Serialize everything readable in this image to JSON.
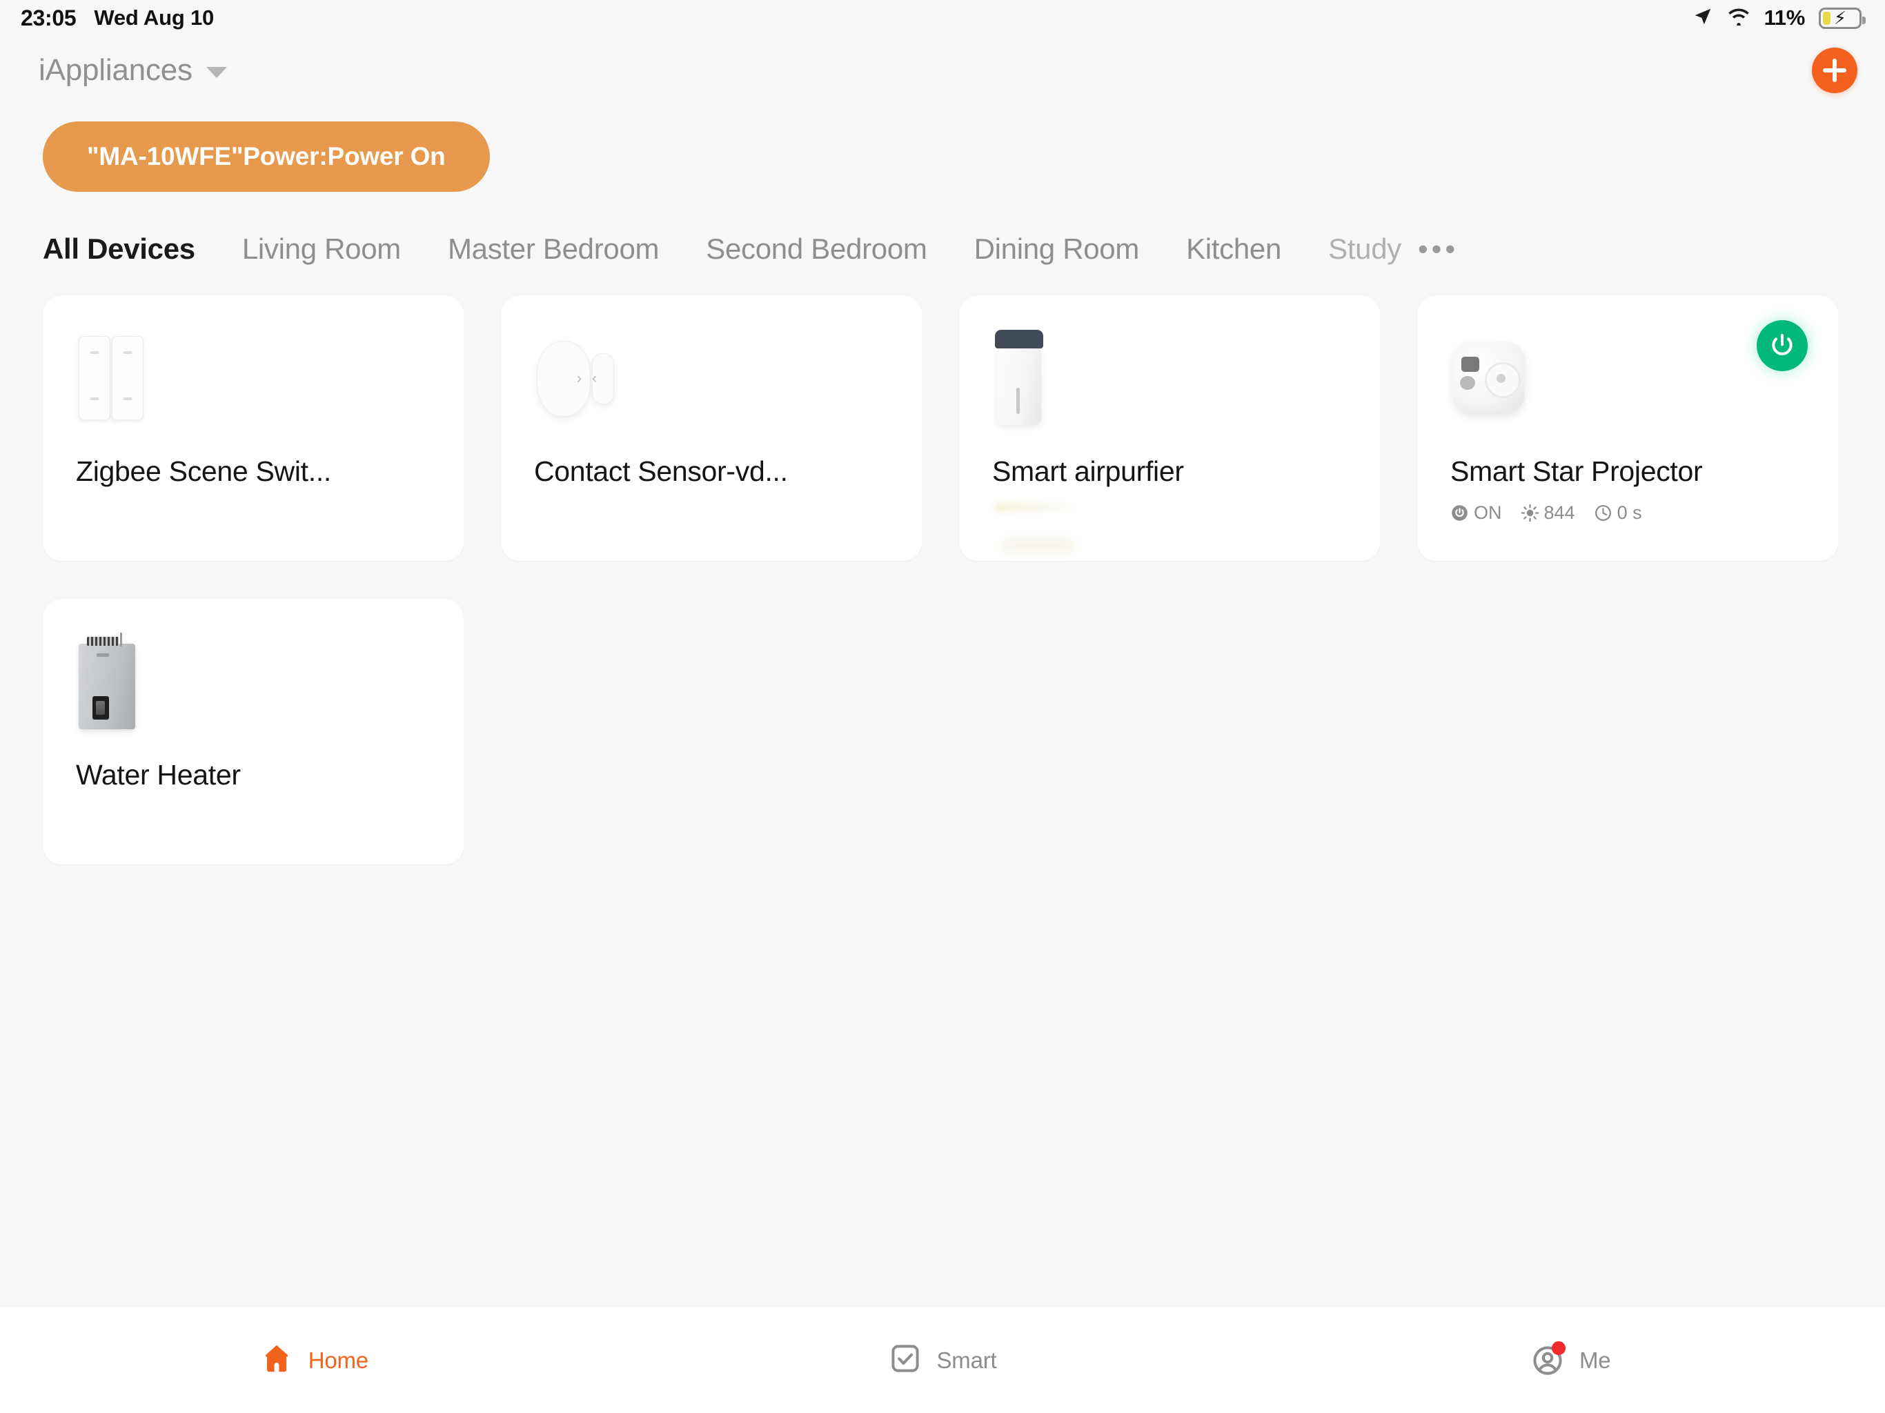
{
  "status_bar": {
    "time": "23:05",
    "date": "Wed Aug 10",
    "battery_percent": "11%",
    "icons": [
      "location-arrow-icon",
      "wifi-icon",
      "battery-charging-icon"
    ]
  },
  "header": {
    "home_name": "iAppliances",
    "dropdown_icon": "chevron-down-icon",
    "add_button_icon": "plus-icon"
  },
  "toast": {
    "message": "\"MA-10WFE\"Power:Power On",
    "background_color": "#e79a4d",
    "text_color": "#ffffff"
  },
  "tabs": {
    "items": [
      {
        "label": "All Devices",
        "active": true
      },
      {
        "label": "Living Room",
        "active": false
      },
      {
        "label": "Master Bedroom",
        "active": false
      },
      {
        "label": "Second Bedroom",
        "active": false
      },
      {
        "label": "Dining Room",
        "active": false
      },
      {
        "label": "Kitchen",
        "active": false
      },
      {
        "label": "Study",
        "active": false
      }
    ],
    "overflow_label": "•••"
  },
  "devices": [
    {
      "name": "Zigbee Scene Swit...",
      "icon": "wall-switch-icon",
      "has_toggle": false,
      "status": []
    },
    {
      "name": "Contact Sensor-vd...",
      "icon": "contact-sensor-icon",
      "has_toggle": false,
      "status": []
    },
    {
      "name": "Smart airpurfier",
      "icon": "air-purifier-icon",
      "has_toggle": false,
      "status": []
    },
    {
      "name": "Smart Star Projector",
      "icon": "star-projector-icon",
      "has_toggle": true,
      "toggle_state": "on",
      "toggle_color": "#00b87c",
      "status": [
        {
          "icon": "power-icon",
          "value": "ON"
        },
        {
          "icon": "brightness-icon",
          "value": "844"
        },
        {
          "icon": "clock-icon",
          "value": "0 s"
        }
      ]
    },
    {
      "name": "Water Heater",
      "icon": "water-heater-icon",
      "has_toggle": false,
      "status": []
    }
  ],
  "bottom_nav": {
    "items": [
      {
        "label": "Home",
        "icon": "house-icon",
        "active": true,
        "badge": false
      },
      {
        "label": "Smart",
        "icon": "checkbox-icon",
        "active": false,
        "badge": false
      },
      {
        "label": "Me",
        "icon": "person-circle-icon",
        "active": false,
        "badge": true
      }
    ],
    "active_color": "#f4631e",
    "inactive_color": "#8d8d8d",
    "badge_color": "#f02b2b"
  }
}
